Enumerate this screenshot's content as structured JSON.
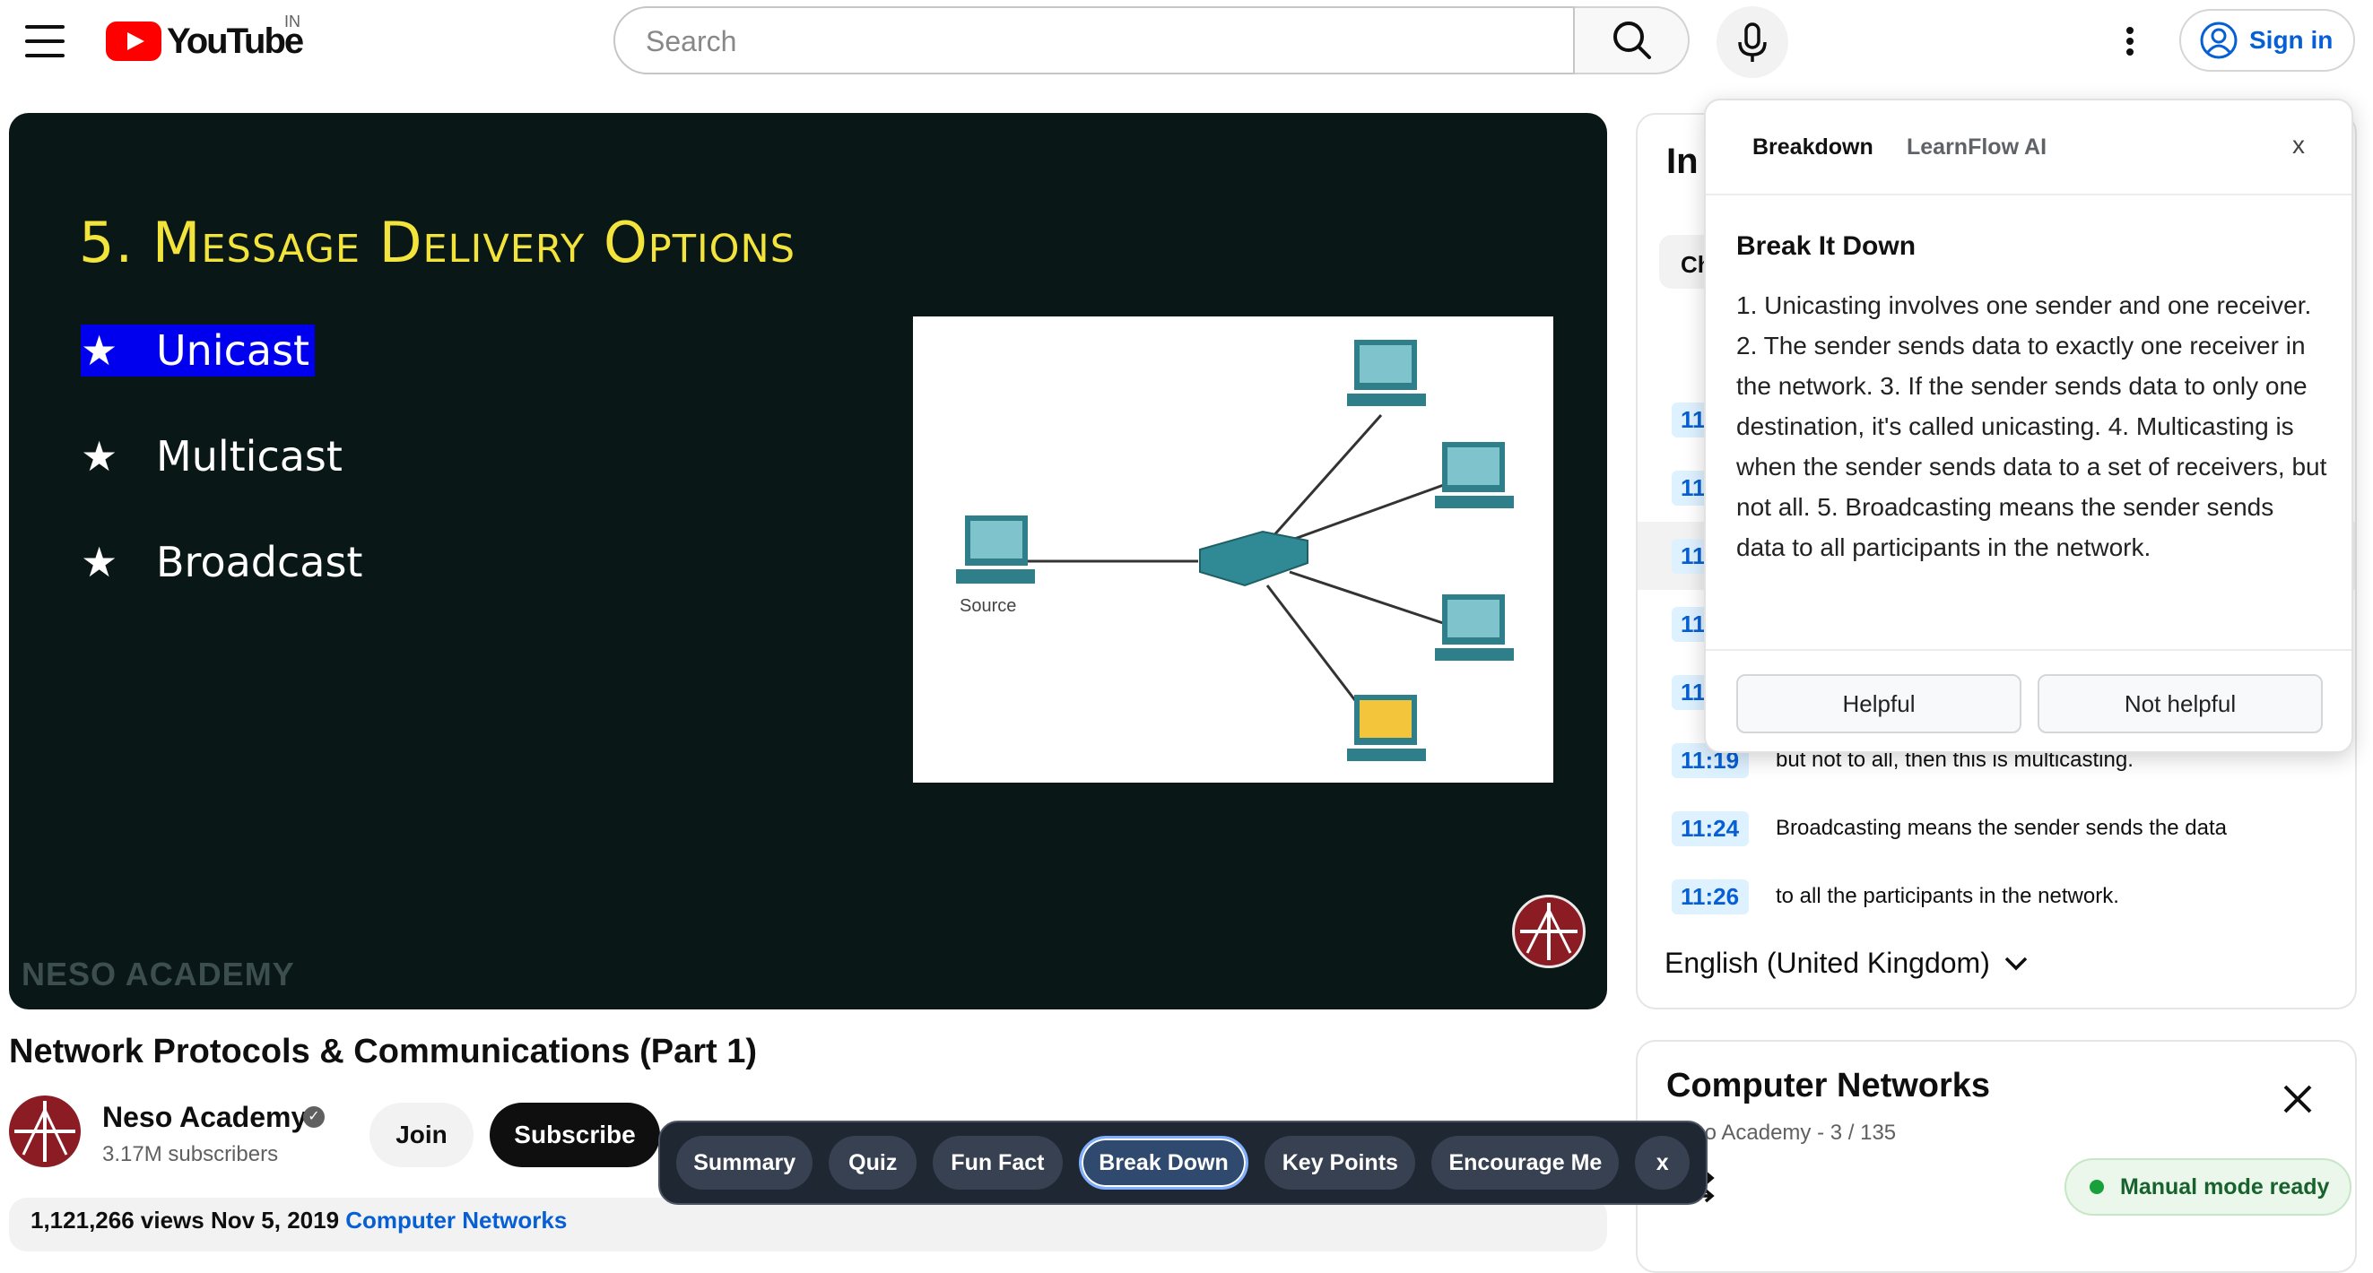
{
  "masthead": {
    "logo_text": "YouTube",
    "country": "IN",
    "search_placeholder": "Search",
    "signin_label": "Sign in"
  },
  "player": {
    "slide_title": "5. Message Delivery Options",
    "bullets": [
      "Unicast",
      "Multicast",
      "Broadcast"
    ],
    "highlighted_bullet": "Unicast",
    "diagram_label": "Source",
    "watermark": "NESO ACADEMY"
  },
  "video": {
    "title": "Network Protocols & Communications (Part 1)",
    "channel_name": "Neso Academy",
    "subscribers": "3.17M subscribers",
    "join_label": "Join",
    "subscribe_label": "Subscribe",
    "views_text": "1,121,266 views  Nov 5, 2019",
    "views_link": "Computer Networks"
  },
  "action_bar": {
    "chips": [
      "Summary",
      "Quiz",
      "Fun Fact",
      "Break Down",
      "Key Points",
      "Encourage Me"
    ],
    "active_chip": "Break Down",
    "close_label": "x"
  },
  "transcript": {
    "heading": "In",
    "chip": "Ch",
    "segments": [
      {
        "time": "11:",
        "text": ""
      },
      {
        "time": "11:",
        "text": ""
      },
      {
        "time": "11:",
        "text": ""
      },
      {
        "time": "11:",
        "text": ""
      },
      {
        "time": "11:",
        "text": ""
      },
      {
        "time": "11:19",
        "text": "but not to all, then this is multicasting."
      },
      {
        "time": "11:24",
        "text": "Broadcasting means the sender sends the data"
      },
      {
        "time": "11:26",
        "text": "to all the participants in the network."
      }
    ],
    "language": "English (United Kingdom)"
  },
  "popup": {
    "tabs": [
      "Breakdown",
      "LearnFlow AI"
    ],
    "active_tab": "Breakdown",
    "close_label": "x",
    "heading": "Break It Down",
    "body": "1. Unicasting involves one sender and one receiver. 2. The sender sends data to exactly one receiver in the network. 3. If the sender sends data to only one destination, it's called unicasting. 4. Multicasting is when the sender sends data to a set of receivers, but not all. 5. Broadcasting means the sender sends data to all participants in the network.",
    "helpful_label": "Helpful",
    "not_helpful_label": "Not helpful"
  },
  "playlist": {
    "title": "Computer Networks",
    "subtitle": "Neso Academy - 3 / 135"
  },
  "toast": {
    "text": "Manual mode ready"
  },
  "colors": {
    "youtube_red": "#ff0000",
    "link_blue": "#065fd4",
    "slide_title_yellow": "#f3e43c",
    "highlight_blue": "#0000ee",
    "toolbar_dark": "#1f2733",
    "toast_green": "#18622d"
  }
}
